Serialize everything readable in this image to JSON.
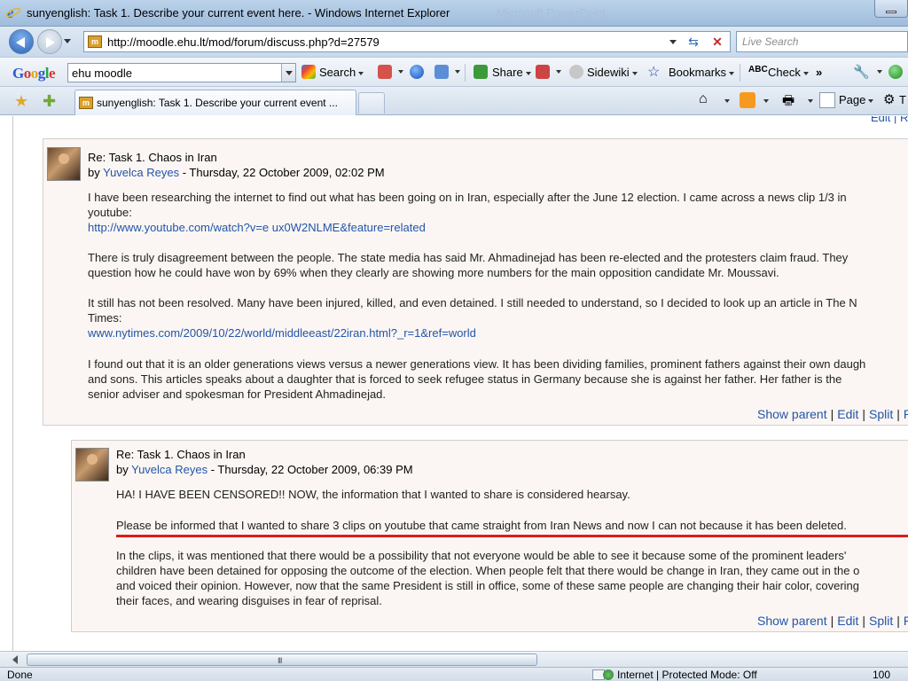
{
  "window": {
    "title": "sunyenglish: Task 1. Describe your current event here. - Windows Internet Explorer",
    "ghost_title": "Microsoft PowerPoint"
  },
  "address_bar": {
    "url": "http://moodle.ehu.lt/mod/forum/discuss.php?d=27579",
    "search_placeholder": "Live Search"
  },
  "google_toolbar": {
    "logo": {
      "letters": [
        "G",
        "o",
        "o",
        "g",
        "l",
        "e"
      ]
    },
    "search_value": "ehu moodle",
    "search_label": "Search",
    "share_label": "Share",
    "sidewiki_label": "Sidewiki",
    "bookmarks_label": "Bookmarks",
    "check_label": "Check",
    "more_label": "»"
  },
  "tabs": {
    "active_label": "sunyenglish: Task 1. Describe your current event ...",
    "page_label": "Page",
    "tools_label": "T"
  },
  "top_links": "Edit | R",
  "posts": [
    {
      "title": "Re: Task 1. Chaos in Iran",
      "by_prefix": "by ",
      "author": "Yuvelca Reyes",
      "date": " - Thursday, 22 October 2009, 02:02 PM",
      "lines": [
        "I have been researching the internet to find out what has been going on in Iran, especially after the June 12 election. I came across a news clip 1/3 in",
        "youtube:",
        "There is truly disagreement between the people. The state media has said Mr. Ahmadinejad has been re-elected and the protesters claim fraud. They",
        "question how he could have won by 69% when they clearly are showing more numbers for the main opposition candidate Mr. Moussavi.",
        "It still has not been resolved. Many have been injured, killed, and even detained. I still needed to understand, so I decided to look up an article in The N",
        "Times:",
        "I found out that it is an older generations views versus a newer generations view. It has been dividing families, prominent fathers against their own daugh",
        "and sons. This articles speaks about a daughter that is forced to seek refugee status in Germany because she is against her father. Her father is the",
        "senior adviser and spokesman for President Ahmadinejad."
      ],
      "link1": "http://www.youtube.com/watch?v=e ux0W2NLME&feature=related",
      "link2": "www.nytimes.com/2009/10/22/world/middleeast/22iran.html?_r=1&ref=world",
      "footer": {
        "show_parent": "Show parent",
        "edit": "Edit",
        "split": "Split",
        "more": "R",
        "sep": "|"
      }
    },
    {
      "title": "Re: Task 1. Chaos in Iran",
      "by_prefix": "by ",
      "author": "Yuvelca Reyes",
      "date": " - Thursday, 22 October 2009, 06:39 PM",
      "lines": [
        "HA! I HAVE BEEN CENSORED!! NOW, the information that I wanted to share is considered hearsay.",
        "Please be informed that I wanted to share 3 clips on youtube that came straight from Iran News and now I can not because it has been deleted.",
        "In the clips, it was mentioned that there would be a possibility that not everyone would be able to see it because some of the prominent leaders'",
        "children have been detained for opposing the outcome of the election. When people felt that there would be change in Iran, they came out in the o",
        "and voiced their opinion. However, now that the same President is still in office, some of these same people are changing their hair color, covering",
        "their faces, and wearing disguises in fear of reprisal."
      ],
      "footer": {
        "show_parent": "Show parent",
        "edit": "Edit",
        "split": "Split",
        "more": "R",
        "sep": "|"
      }
    }
  ],
  "scrollbar": {
    "grip": "III"
  },
  "status": {
    "done": "Done",
    "zone": "Internet | Protected Mode: Off",
    "zoom": "100"
  },
  "colors": {
    "link": "#2255aa",
    "highlight_line": "#e01b1b",
    "post_bg": "#fbf6f3"
  }
}
